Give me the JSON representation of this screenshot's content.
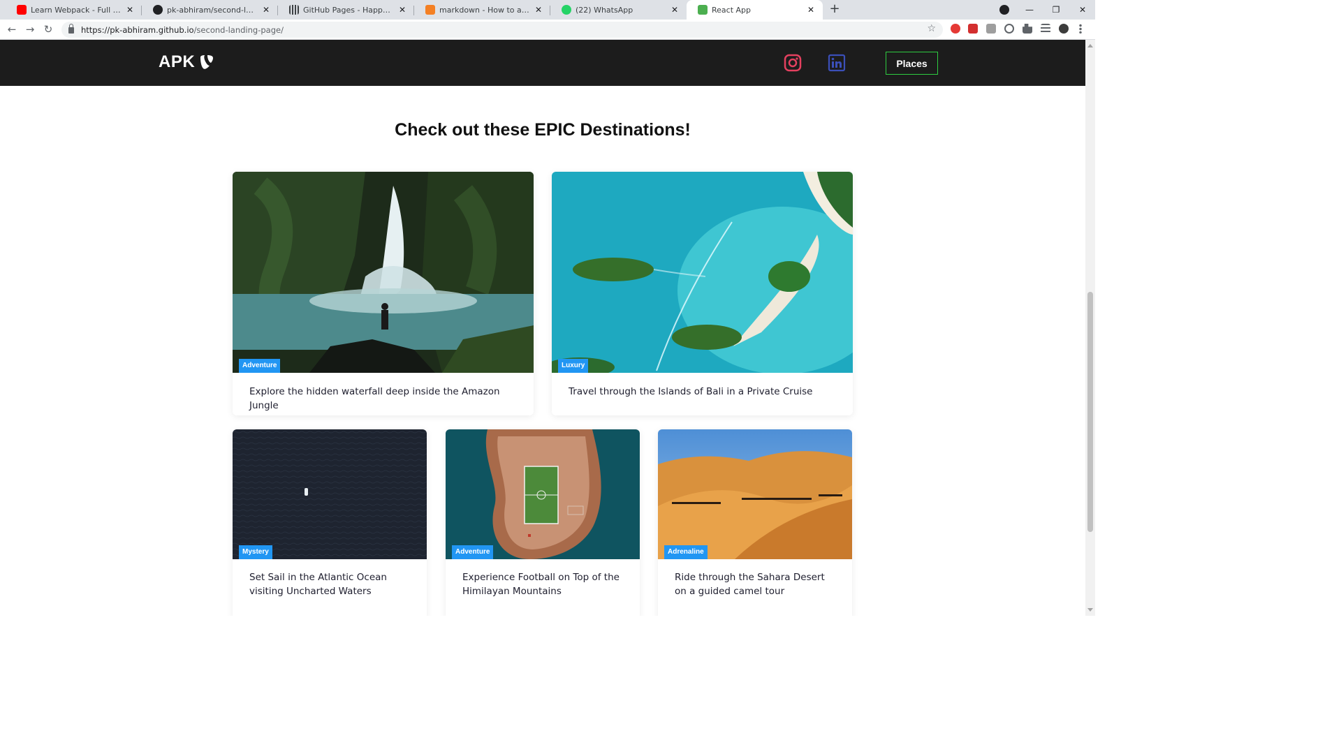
{
  "browser": {
    "tabs": [
      {
        "title": "Learn Webpack - Full Tutorial for",
        "favicon": "youtube-icon",
        "color": "#ff0000"
      },
      {
        "title": "pk-abhiram/second-landing-pag",
        "favicon": "github-icon",
        "color": "#202124"
      },
      {
        "title": "GitHub Pages - Happy Coding",
        "favicon": "grid-icon",
        "color": "#3c4043"
      },
      {
        "title": "markdown - How to add images",
        "favicon": "stackoverflow-icon",
        "color": "#f48024"
      },
      {
        "title": "(22) WhatsApp",
        "favicon": "whatsapp-icon",
        "color": "#25d366"
      },
      {
        "title": "React App",
        "favicon": "react-app-icon",
        "color": "#4caf50"
      }
    ],
    "url_host": "https://pk-abhiram.github.io",
    "url_path": "/second-landing-page/"
  },
  "site": {
    "logo_text": "APK",
    "places_label": "Places",
    "section_title": "Check out these EPIC Destinations!",
    "cards": [
      {
        "badge": "Adventure",
        "title": "Explore the hidden waterfall deep inside the Amazon Jungle",
        "scene": "waterfall"
      },
      {
        "badge": "Luxury",
        "title": "Travel through the Islands of Bali in a Private Cruise",
        "scene": "islands"
      },
      {
        "badge": "Mystery",
        "title": "Set Sail in the Atlantic Ocean visiting Uncharted Waters",
        "scene": "ocean"
      },
      {
        "badge": "Adventure",
        "title": "Experience Football on Top of the Himilayan Mountains",
        "scene": "football"
      },
      {
        "badge": "Adrenaline",
        "title": "Ride through the Sahara Desert on a guided camel tour",
        "scene": "desert"
      }
    ]
  },
  "colors": {
    "header_bg": "#1c1c1c",
    "places_border": "#2ecc40",
    "badge_bg": "#2196f3",
    "instagram": "#e4405f",
    "linkedin": "#3b4fb8"
  }
}
